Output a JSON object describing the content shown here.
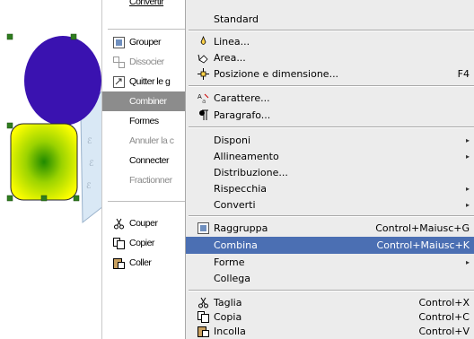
{
  "menu_fr": {
    "items": [
      {
        "label": "Convertir",
        "state": "partial"
      },
      {
        "label": "Grouper",
        "icon": "group-icon"
      },
      {
        "label": "Dissocier",
        "icon": "ungroup-icon",
        "state": "disabled"
      },
      {
        "label": "Quitter le g",
        "icon": "exit-group-icon"
      },
      {
        "label": "Combiner",
        "state": "highlighted"
      },
      {
        "label": "Formes"
      },
      {
        "label": "Annuler la c",
        "state": "disabled"
      },
      {
        "label": "Connecter"
      },
      {
        "label": "Fractionner",
        "state": "disabled"
      },
      {
        "label": "Couper",
        "icon": "scissors-icon"
      },
      {
        "label": "Copier",
        "icon": "copy-icon"
      },
      {
        "label": "Coller",
        "icon": "paste-icon"
      }
    ]
  },
  "menu_it": {
    "items": [
      {
        "label": "Standard"
      },
      {
        "label": "Linea...",
        "icon": "line-icon"
      },
      {
        "label": "Area...",
        "icon": "area-icon"
      },
      {
        "label": "Posizione e dimensione...",
        "icon": "position-icon",
        "shortcut": "F4"
      },
      {
        "label": "Carattere...",
        "icon": "character-icon"
      },
      {
        "label": "Paragrafo...",
        "icon": "paragraph-icon"
      },
      {
        "label": "Disponi",
        "submenu": true
      },
      {
        "label": "Allineamento",
        "submenu": true
      },
      {
        "label": "Distribuzione..."
      },
      {
        "label": "Rispecchia",
        "submenu": true
      },
      {
        "label": "Converti",
        "submenu": true
      },
      {
        "label": "Raggruppa",
        "icon": "group-icon",
        "shortcut": "Control+Maiusc+G"
      },
      {
        "label": "Combina",
        "shortcut": "Control+Maiusc+K",
        "state": "highlighted"
      },
      {
        "label": "Forme",
        "submenu": true
      },
      {
        "label": "Collega"
      },
      {
        "label": "Taglia",
        "icon": "scissors-icon",
        "shortcut": "Control+X"
      },
      {
        "label": "Copia",
        "icon": "copy-icon",
        "shortcut": "Control+C"
      },
      {
        "label": "Incolla",
        "icon": "paste-icon",
        "shortcut": "Control+V"
      }
    ]
  },
  "colors": {
    "italian_highlight": "#4b6fb3",
    "french_highlight": "#8c8c8c",
    "ellipse_fill": "#3a12b0",
    "gradient_center": "#1f8a00",
    "gradient_edge": "#ffff00",
    "handle": "#2f7d1f"
  }
}
